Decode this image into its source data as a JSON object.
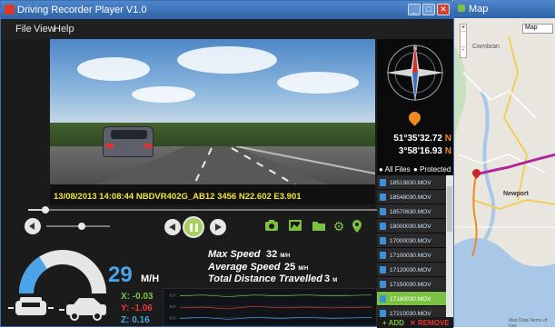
{
  "app": {
    "title": "Driving Recorder Player V1.0"
  },
  "menu": [
    "File",
    "View",
    "Help"
  ],
  "video": {
    "overlay": "13/08/2013  14:08:44  NBDVR402G_AB12 3456  N22.602  E3.901"
  },
  "gps": {
    "lat": "51°35'32.72",
    "lat_dir": "N",
    "lon": "3°58'16.93",
    "lon_dir": "N"
  },
  "file_tabs": {
    "all": "All Files",
    "protected": "Protected"
  },
  "files": [
    {
      "name": "18519830.MOV",
      "selected": false
    },
    {
      "name": "18548030.MOV",
      "selected": false
    },
    {
      "name": "18570630.MOV",
      "selected": false
    },
    {
      "name": "18000030.MOV",
      "selected": false
    },
    {
      "name": "17000030.MOV",
      "selected": false
    },
    {
      "name": "17100030.MOV",
      "selected": false
    },
    {
      "name": "17120030.MOV",
      "selected": false
    },
    {
      "name": "17150030.MOV",
      "selected": false
    },
    {
      "name": "17180030.MOV",
      "selected": true
    },
    {
      "name": "17210030.MOV",
      "selected": false
    }
  ],
  "file_actions": {
    "add": "ADD",
    "remove": "REMOVE"
  },
  "playback": {
    "progress_fraction": 0.05,
    "volume_fraction": 0.55
  },
  "speed": {
    "value": "29",
    "unit": "M/H",
    "gauge_fraction": 0.32
  },
  "stats": {
    "max_speed_label": "Max Speed",
    "max_speed_value": "32",
    "max_speed_unit": "M/H",
    "avg_speed_label": "Average Speed",
    "avg_speed_value": "25",
    "avg_speed_unit": "M/H",
    "distance_label": "Total Distance Travelled",
    "distance_value": "3",
    "distance_unit": "M"
  },
  "gsensor": {
    "x_label": "X:",
    "x_value": "-0.03",
    "y_label": "Y:",
    "y_value": "-1.06",
    "z_label": "Z:",
    "z_value": "0.16",
    "colors": {
      "x": "#7cc242",
      "y": "#e53935",
      "z": "#4ba3e8"
    },
    "graph_ticks": [
      "0.0",
      "0.0",
      "0.0"
    ]
  },
  "map": {
    "title": "Map",
    "type_select": "Map",
    "zoom_plus": "+",
    "zoom_minus": "-",
    "places": [
      "Cwmbran",
      "Newport"
    ],
    "footer": "Map Data  Terms of Use"
  },
  "colors": {
    "accent_green": "#7cc242",
    "accent_orange": "#f08a25",
    "speed_blue": "#4ba3e8",
    "route": "#b0279b"
  }
}
